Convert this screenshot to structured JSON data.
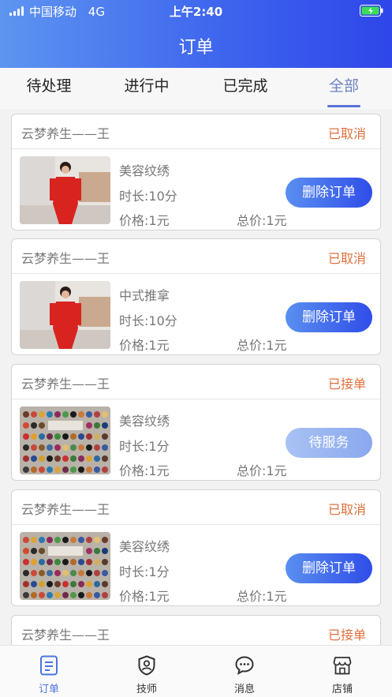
{
  "status_bar": {
    "carrier": "中国移动",
    "network": "4G",
    "time": "上午2:40"
  },
  "header": {
    "title": "订单"
  },
  "tabs": [
    {
      "label": "待处理",
      "active": false
    },
    {
      "label": "进行中",
      "active": false
    },
    {
      "label": "已完成",
      "active": false
    },
    {
      "label": "全部",
      "active": true
    }
  ],
  "orders": [
    {
      "shop": "云梦养生——王",
      "status": "已取消",
      "service": "美容纹绣",
      "duration": "时长:10分",
      "price": "价格:1元",
      "total": "总价:1元",
      "action": "删除订单",
      "image": "woman-red-outfit"
    },
    {
      "shop": "云梦养生——王",
      "status": "已取消",
      "service": "中式推拿",
      "duration": "时长:10分",
      "price": "价格:1元",
      "total": "总价:1元",
      "action": "删除订单",
      "image": "woman-red-outfit"
    },
    {
      "shop": "云梦养生——王",
      "status": "已接单",
      "service": "美容纹绣",
      "duration": "时长:1分",
      "price": "价格:1元",
      "total": "总价:1元",
      "action": "待服务",
      "image": "color-palette-board"
    },
    {
      "shop": "云梦养生——王",
      "status": "已取消",
      "service": "美容纹绣",
      "duration": "时长:1分",
      "price": "价格:1元",
      "total": "总价:1元",
      "action": "删除订单",
      "image": "color-palette-board"
    },
    {
      "shop": "云梦养生——王",
      "status": "已接单"
    }
  ],
  "bottom_nav": [
    {
      "label": "订单",
      "icon": "order-icon",
      "active": true
    },
    {
      "label": "技师",
      "icon": "technician-icon",
      "active": false
    },
    {
      "label": "消息",
      "icon": "message-icon",
      "active": false
    },
    {
      "label": "店铺",
      "icon": "store-icon",
      "active": false
    }
  ],
  "colors": {
    "header_start": "#5d95f0",
    "header_end": "#2e46ea",
    "status_text": "#e0703c",
    "active_tab": "#6c82c3",
    "nav_active": "#4a74e3"
  }
}
